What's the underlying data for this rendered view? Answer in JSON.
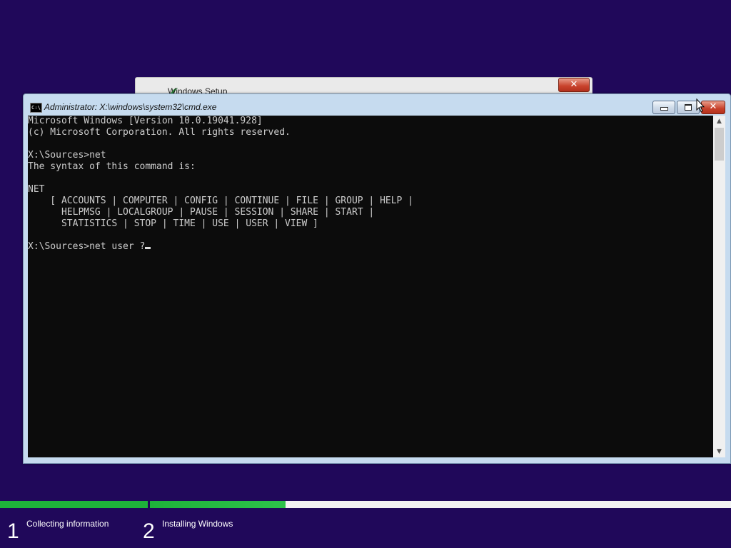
{
  "background_color": "#20085a",
  "setup_window": {
    "title": "Windows Setup",
    "close_label": "✕"
  },
  "cmd_window": {
    "title": "Administrator: X:\\windows\\system32\\cmd.exe",
    "icon_text": "C:\\",
    "close_label": "✕",
    "console_text": "Microsoft Windows [Version 10.0.19041.928]\n(c) Microsoft Corporation. All rights reserved.\n\nX:\\Sources>net\nThe syntax of this command is:\n\nNET\n    [ ACCOUNTS | COMPUTER | CONFIG | CONTINUE | FILE | GROUP | HELP |\n      HELPMSG | LOCALGROUP | PAUSE | SESSION | SHARE | START |\n      STATISTICS | STOP | TIME | USE | USER | VIEW ]\n\nX:\\Sources>net user ?",
    "scroll_up": "▲",
    "scroll_down": "▼"
  },
  "progress": {
    "steps": [
      {
        "number": "1",
        "label": "Collecting information",
        "completed": true
      },
      {
        "number": "2",
        "label": "Installing Windows",
        "progress_fraction": 0.23
      }
    ],
    "color": "#1eb33a"
  }
}
